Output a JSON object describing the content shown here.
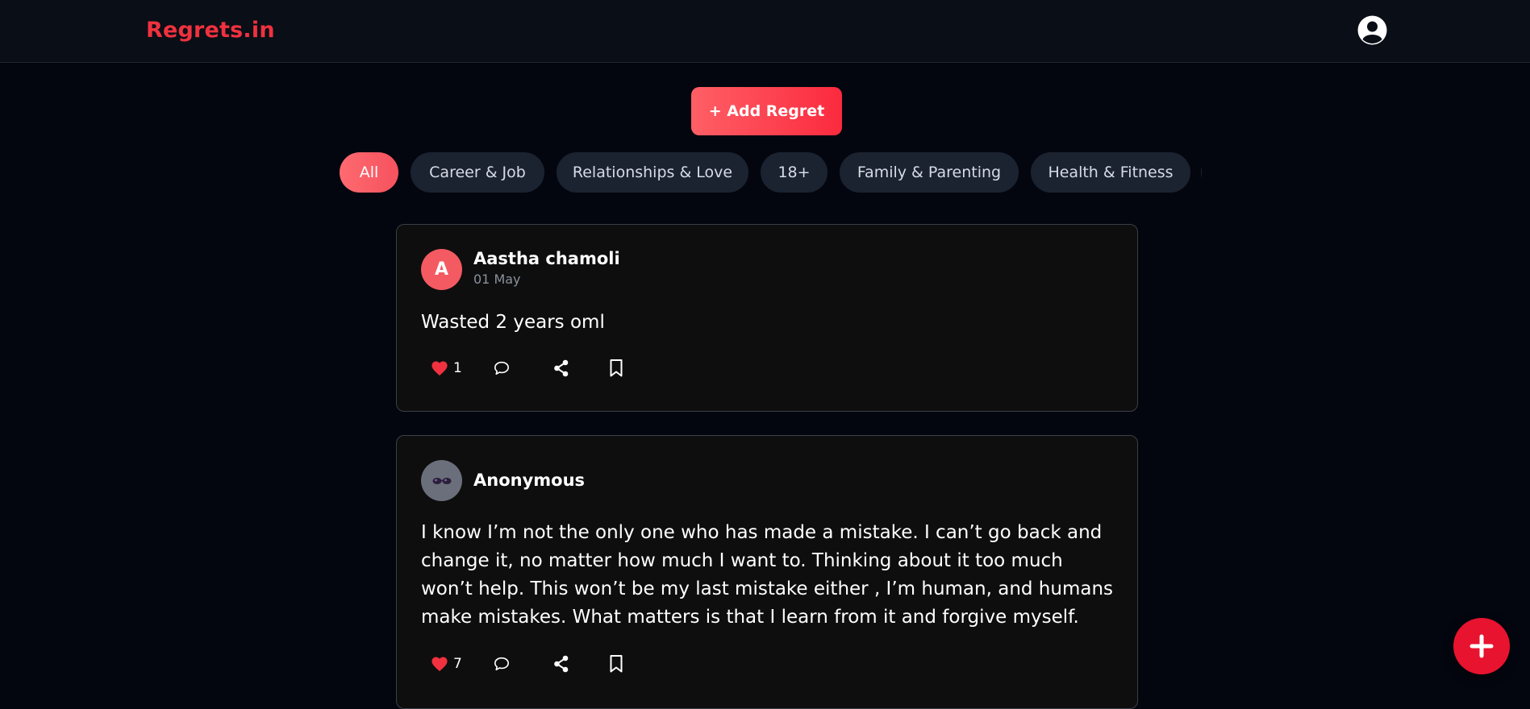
{
  "header": {
    "brand": "Regrets.in",
    "profile_icon": "user-circle-icon"
  },
  "add_button": {
    "label": "+ Add Regret"
  },
  "categories": [
    {
      "label": "All",
      "active": true
    },
    {
      "label": "Career & Job",
      "active": false
    },
    {
      "label": "Relationships & Love",
      "active": false
    },
    {
      "label": "18+",
      "active": false
    },
    {
      "label": "Family & Parenting",
      "active": false
    },
    {
      "label": "Health & Fitness",
      "active": false
    }
  ],
  "posts": [
    {
      "avatar_letter": "A",
      "author": "Aastha chamoli",
      "date": "01 May",
      "content": "Wasted 2 years oml",
      "likes": "1"
    },
    {
      "avatar_icon": "sunglasses-face-icon",
      "author": "Anonymous",
      "content": "I know I’m not the only one who has made a mistake. I can’t go back and change it, no matter how much I want to. Thinking about it too much won’t help. This won’t be my last mistake either , I’m human, and humans make mistakes. What matters is that I learn from it and forgive myself.",
      "likes": "7"
    }
  ],
  "colors": {
    "brand": "#f0313f",
    "accent": "#fb2a3e",
    "like": "#f0313f",
    "background": "#04060f",
    "card": "#0e0e0e",
    "chip": "#1b2331"
  },
  "icons": {
    "like": "heart-icon",
    "comment": "comment-icon",
    "share": "share-icon",
    "bookmark": "bookmark-icon",
    "fab": "plus-icon"
  }
}
